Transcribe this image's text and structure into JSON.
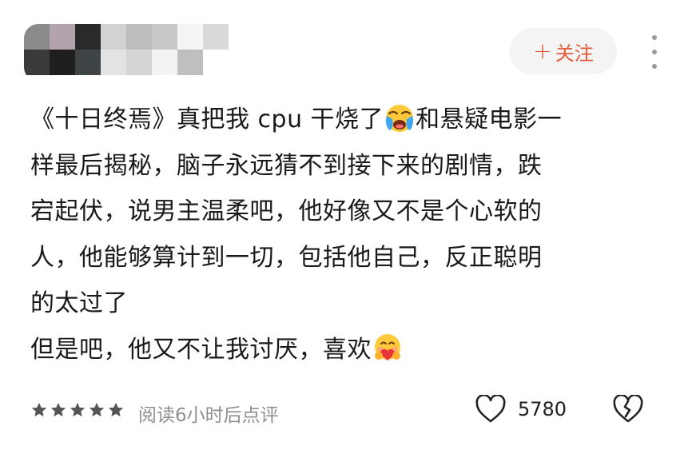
{
  "header": {
    "follow_label": "关注",
    "follow_plus": "+"
  },
  "post": {
    "lines": [
      {
        "before": "《十日终焉》真把我 cpu 干烧了",
        "emoji": "crying-face",
        "after": "和悬疑电影一"
      },
      {
        "before": "样最后揭秘，脑子永远猜不到接下来的剧情，跌",
        "emoji": null,
        "after": ""
      },
      {
        "before": "宕起伏，说男主温柔吧，他好像又不是个心软的",
        "emoji": null,
        "after": ""
      },
      {
        "before": "人，他能够算计到一切，包括他自己，反正聪明",
        "emoji": null,
        "after": ""
      },
      {
        "before": "的太过了",
        "emoji": null,
        "after": ""
      },
      {
        "before": "但是吧，他又不让我讨厌，喜欢",
        "emoji": "heart-hug-face",
        "after": ""
      }
    ]
  },
  "footer": {
    "rating_stars": 5,
    "read_note": "阅读6小时后点评",
    "like_count": "5780"
  },
  "colors": {
    "accent": "#e35a3a",
    "muted": "#8f8f8f",
    "text": "#1a1a1a"
  }
}
